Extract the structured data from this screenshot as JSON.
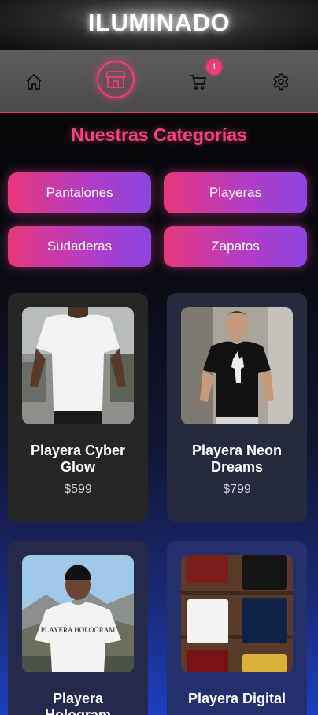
{
  "app": {
    "title": "ILUMINADO"
  },
  "nav": {
    "items": [
      {
        "icon": "home-icon"
      },
      {
        "icon": "store-icon",
        "active": true
      },
      {
        "icon": "cart-icon",
        "badge": "1"
      },
      {
        "icon": "gear-icon"
      }
    ]
  },
  "categories": {
    "title": "Nuestras Categorías",
    "items": [
      "Pantalones",
      "Playeras",
      "Sudaderas",
      "Zapatos"
    ]
  },
  "products": [
    {
      "name": "Playera Cyber Glow",
      "price": "$599"
    },
    {
      "name": "Playera Neon Dreams",
      "price": "$799"
    },
    {
      "name": "Playera Hologram",
      "price": ""
    },
    {
      "name": "Playera Digital",
      "price": ""
    }
  ],
  "colors": {
    "accent": "#ec3d74",
    "gradient_start": "#e6397a",
    "gradient_end": "#8a45e0",
    "background_top": "#050505",
    "background_bottom": "#1f3fc0"
  }
}
